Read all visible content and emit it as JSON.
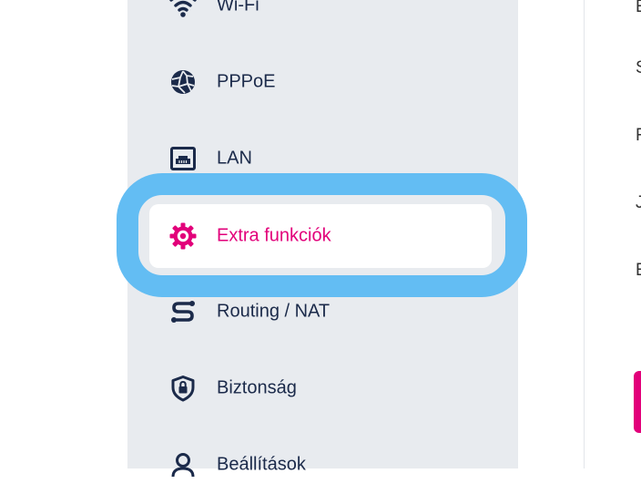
{
  "colors": {
    "accent": "#e2007a",
    "highlight": "#63bdf3",
    "text": "#1b2a4a",
    "sidebar_bg": "#e8ebef"
  },
  "sidebar": {
    "items": [
      {
        "label": "Wi-Fi",
        "icon": "wifi-icon"
      },
      {
        "label": "PPPoE",
        "icon": "globe-icon"
      },
      {
        "label": "LAN",
        "icon": "lan-port-icon"
      },
      {
        "label": "Extra funkciók",
        "icon": "gear-icon",
        "active": true
      },
      {
        "label": "Routing / NAT",
        "icon": "routing-icon"
      },
      {
        "label": "Biztonság",
        "icon": "shield-lock-icon"
      },
      {
        "label": "Beállítások",
        "icon": "user-icon"
      }
    ]
  },
  "main": {
    "letters": [
      "E",
      "S",
      "F",
      "J",
      "E"
    ]
  }
}
